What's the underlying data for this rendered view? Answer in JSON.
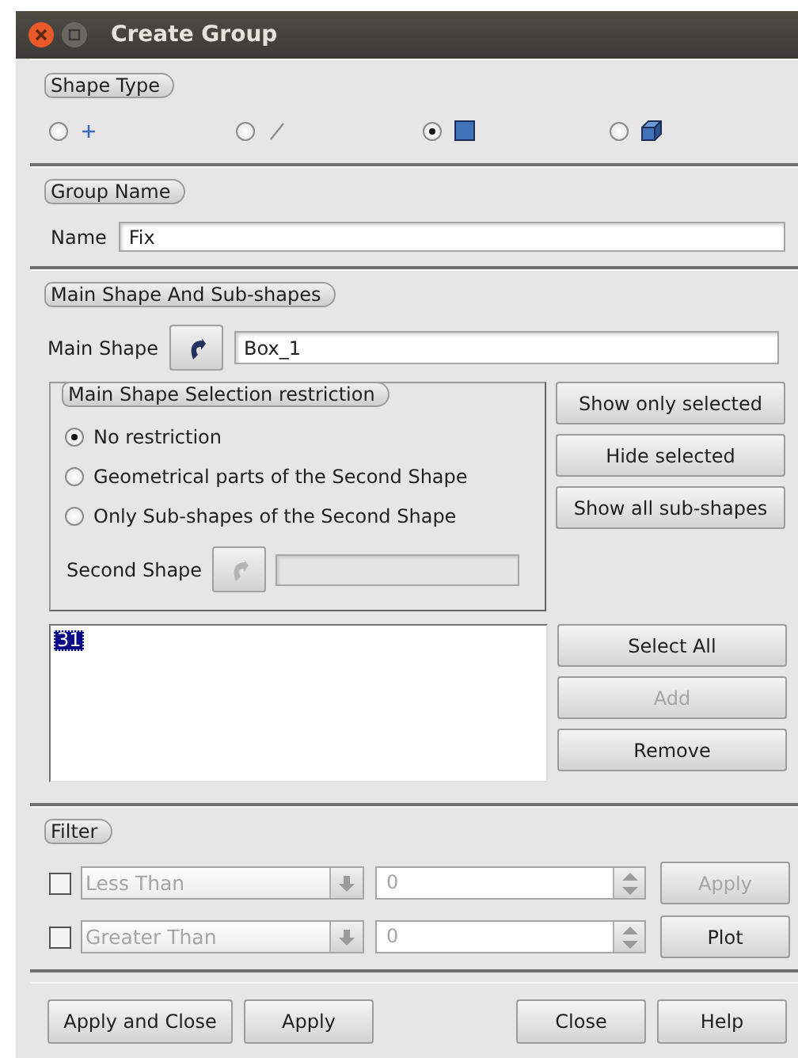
{
  "window": {
    "title": "Create Group"
  },
  "shape_type": {
    "title": "Shape Type",
    "options": [
      {
        "kind": "point",
        "selected": false
      },
      {
        "kind": "edge",
        "selected": false
      },
      {
        "kind": "face",
        "selected": true
      },
      {
        "kind": "solid",
        "selected": false
      }
    ]
  },
  "group_name": {
    "title": "Group Name",
    "label": "Name",
    "value": "Fix"
  },
  "main_shape": {
    "title": "Main Shape And Sub-shapes",
    "label": "Main Shape",
    "value": "Box_1",
    "restriction": {
      "title": "Main Shape Selection restriction",
      "options": [
        {
          "label": "No restriction",
          "selected": true
        },
        {
          "label": "Geometrical parts of the Second Shape",
          "selected": false
        },
        {
          "label": "Only Sub-shapes of the Second Shape",
          "selected": false
        }
      ],
      "second_shape": {
        "label": "Second Shape",
        "disabled": true
      }
    },
    "side_buttons": [
      {
        "label": "Show only selected",
        "disabled": false
      },
      {
        "label": "Hide selected",
        "disabled": false
      },
      {
        "label": "Show all sub-shapes",
        "disabled": false
      }
    ],
    "ids": [
      {
        "label": "31",
        "selected": true
      }
    ],
    "list_buttons": [
      {
        "label": "Select All",
        "disabled": false
      },
      {
        "label": "Add",
        "disabled": true
      },
      {
        "label": "Remove",
        "disabled": false
      }
    ]
  },
  "filter": {
    "title": "Filter",
    "rows": [
      {
        "checked": false,
        "condition": "Less Than",
        "value": "0",
        "disabled": true
      },
      {
        "checked": false,
        "condition": "Greater Than",
        "value": "0",
        "disabled": true
      }
    ],
    "buttons": [
      {
        "label": "Apply",
        "disabled": true
      },
      {
        "label": "Plot",
        "disabled": false
      }
    ]
  },
  "footer": {
    "left_buttons": [
      {
        "label": "Apply and Close"
      },
      {
        "label": "Apply"
      }
    ],
    "right_buttons": [
      {
        "label": "Close"
      },
      {
        "label": "Help"
      }
    ]
  }
}
